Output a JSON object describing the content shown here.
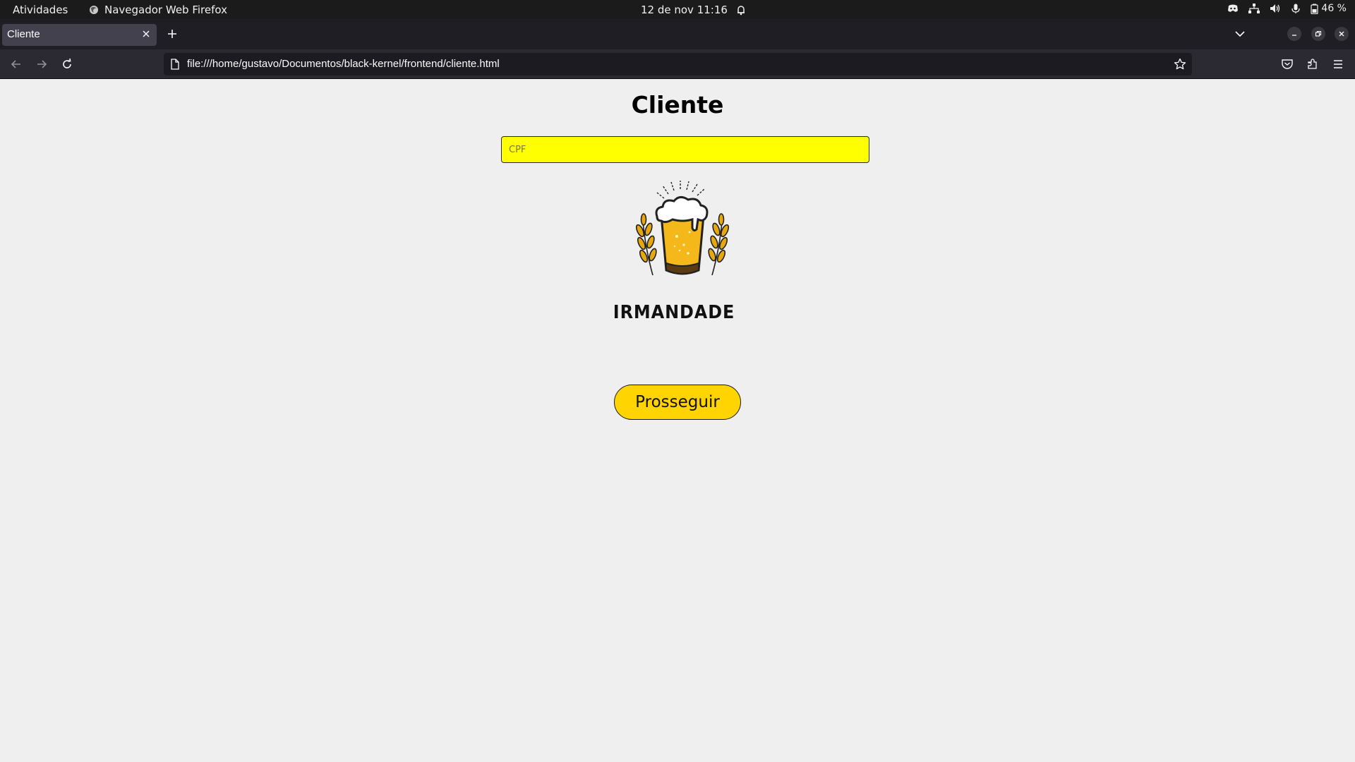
{
  "system_bar": {
    "activities": "Atividades",
    "app_name": "Navegador Web Firefox",
    "clock": "12 de nov  11:16",
    "battery": "46 %"
  },
  "browser": {
    "tab_title": "Cliente",
    "url": "file:///home/gustavo/Documentos/black-kernel/frontend/cliente.html"
  },
  "page": {
    "title": "Cliente",
    "cpf_placeholder": "CPF",
    "cpf_value": "",
    "brand_name": "IRMANDADE",
    "proceed_label": "Prosseguir"
  },
  "colors": {
    "input_bg": "#ffff00",
    "button_bg": "#ffd400",
    "page_bg": "#efefef"
  }
}
